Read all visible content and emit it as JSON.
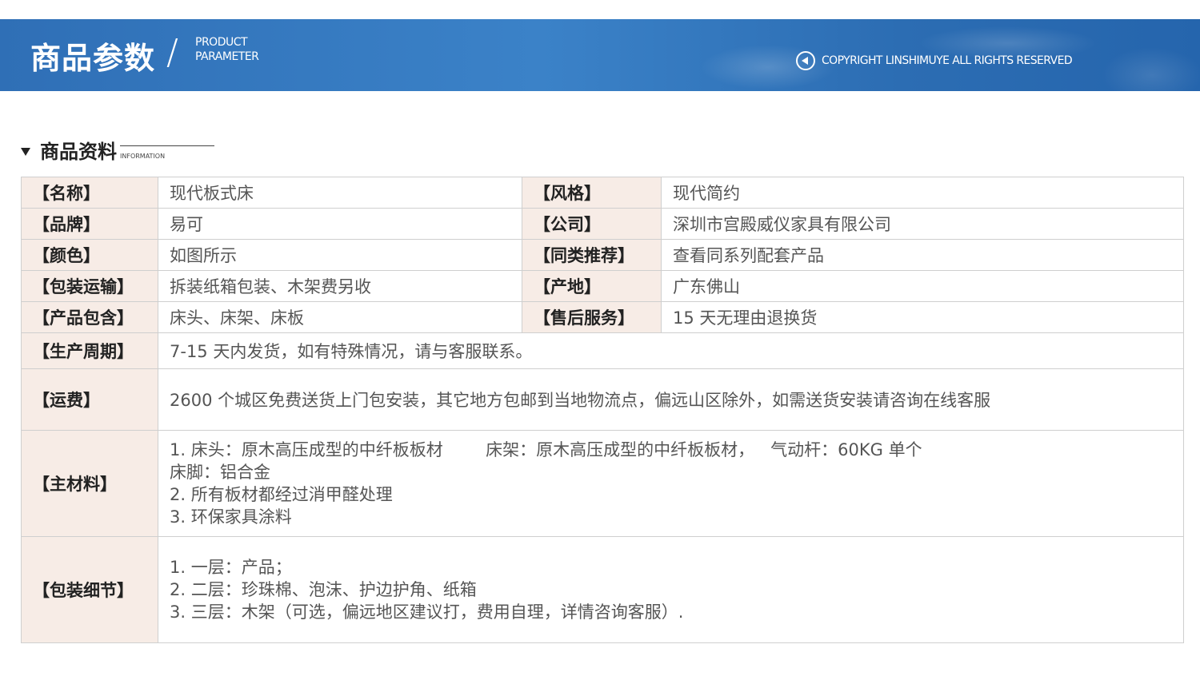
{
  "banner": {
    "title": "商品参数",
    "slash": "/",
    "en_line1": "PRODUCT",
    "en_line2": "PARAMETER",
    "copyright": "COPYRIGHT LINSHIMUYE ALL RIGHTS RESERVED"
  },
  "section": {
    "title": "商品资料",
    "en": "INFORMATION"
  },
  "rows2": [
    {
      "k1": "【名称】",
      "v1": "现代板式床",
      "k2": "【风格】",
      "v2": "现代简约"
    },
    {
      "k1": "【品牌】",
      "v1": "易可",
      "k2": "【公司】",
      "v2": "深圳市宫殿威仪家具有限公司"
    },
    {
      "k1": "【颜色】",
      "v1": "如图所示",
      "k2": "【同类推荐】",
      "v2": "查看同系列配套产品"
    },
    {
      "k1": "【包装运输】",
      "v1": "拆装纸箱包装、木架费另收",
      "k2": "【产地】",
      "v2": "广东佛山"
    },
    {
      "k1": "【产品包含】",
      "v1": "床头、床架、床板",
      "k2": "【售后服务】",
      "v2": "15 天无理由退换货"
    }
  ],
  "cycle": {
    "k": "【生产周期】",
    "v": "7-15 天内发货，如有特殊情况，请与客服联系。"
  },
  "shipping": {
    "k": "【运费】",
    "v": "2600 个城区免费送货上门包安装，其它地方包邮到当地物流点，偏远山区除外，如需送货安装请咨询在线客服"
  },
  "material": {
    "k": "【主材料】",
    "lines": [
      "1. 床头：原木高压成型的中纤板板材        床架：原木高压成型的中纤板板材，   气动杆：60KG 单个",
      "床脚：铝合金",
      "2. 所有板材都经过消甲醛处理",
      "3. 环保家具涂料"
    ]
  },
  "packing": {
    "k": "【包装细节】",
    "lines": [
      "1. 一层：产品；",
      "2. 二层：珍珠棉、泡沫、护边护角、纸箱",
      "3. 三层：木架（可选，偏远地区建议打，费用自理，详情咨询客服）."
    ]
  }
}
